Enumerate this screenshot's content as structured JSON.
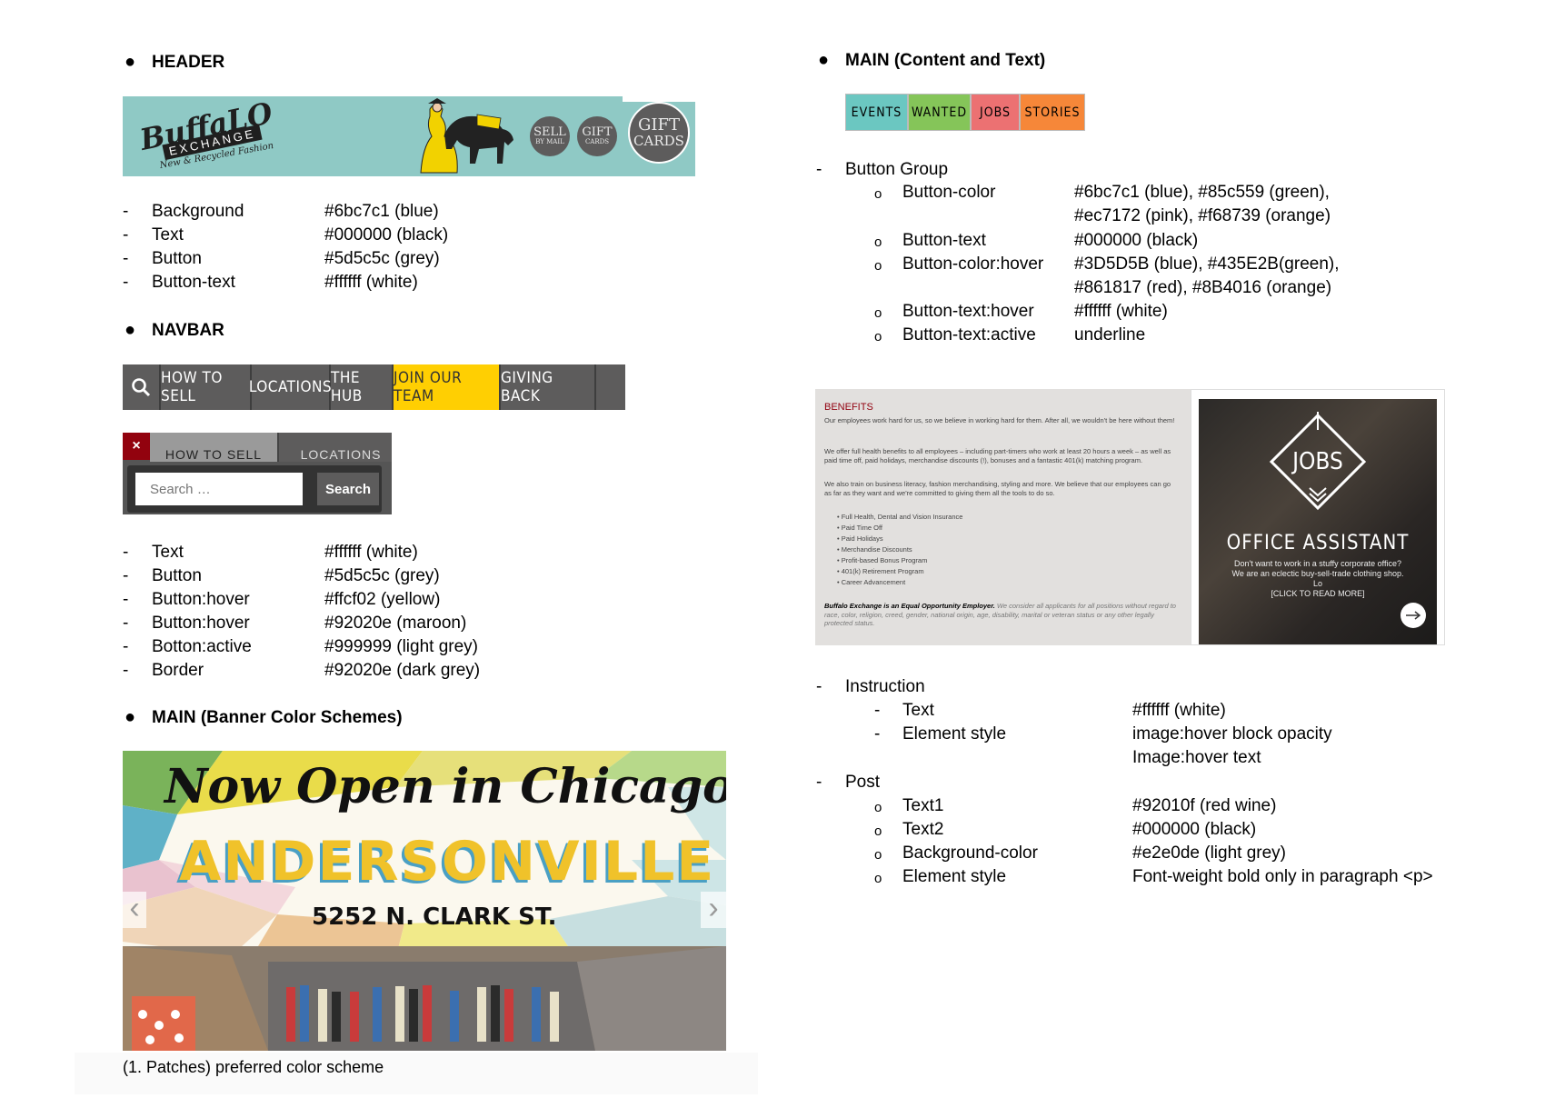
{
  "left": {
    "header_heading": "HEADER",
    "header_image": {
      "logo_word": "BuffaLO",
      "logo_sub": "EXCHANGE",
      "logo_tag": "New & Recycled Fashion",
      "btn_sell_line1": "SELL",
      "btn_sell_line2": "BY MAIL",
      "btn_gift_small_line1": "GIFT",
      "btn_gift_small_line2": "CARDS",
      "btn_gift_big_line1": "GIFT",
      "btn_gift_big_line2": "CARDS"
    },
    "header_props": [
      {
        "label": "Background",
        "value": "#6bc7c1 (blue)"
      },
      {
        "label": "Text",
        "value": "#000000 (black)"
      },
      {
        "label": "Button",
        "value": "#5d5c5c (grey)"
      },
      {
        "label": "Button-text",
        "value": "#ffffff (white)"
      }
    ],
    "navbar_heading": "NAVBAR",
    "navbar_items": [
      "HOW TO SELL",
      "LOCATIONS",
      "THE HUB",
      "JOIN OUR TEAM",
      "GIVING BACK"
    ],
    "navbar_mobile": {
      "close": "×",
      "tab1": "HOW TO SELL",
      "tab2": "LOCATIONS",
      "search_placeholder": "Search …",
      "search_button": "Search"
    },
    "navbar_props": [
      {
        "label": "Text",
        "value": "#ffffff (white)"
      },
      {
        "label": "Button",
        "value": "#5d5c5c (grey)"
      },
      {
        "label": "Button:hover",
        "value": "#ffcf02 (yellow)"
      },
      {
        "label": "Button:hover",
        "value": "#92020e (maroon)"
      },
      {
        "label": "Botton:active",
        "value": "#999999 (light grey)"
      },
      {
        "label": "Border",
        "value": "#92020e (dark grey)"
      }
    ],
    "main_banner_heading": "MAIN (Banner Color Schemes)",
    "banner": {
      "line1": "Now Open in Chicago's",
      "line2": "ANDERSONVILLE",
      "line3": "5252 N. CLARK ST.",
      "prev": "‹",
      "next": "›"
    },
    "banner_caption": "(1. Patches) preferred color scheme"
  },
  "right": {
    "main_content_heading": "MAIN (Content and Text)",
    "tags": [
      {
        "label": "EVENTS",
        "color": "#6bc7c1"
      },
      {
        "label": "WANTED",
        "color": "#85c559"
      },
      {
        "label": "JOBS",
        "color": "#ec7172"
      },
      {
        "label": "STORIES",
        "color": "#f68739"
      }
    ],
    "button_group_label": "Button Group",
    "button_group_props": [
      {
        "label": "Button-color",
        "value": "#6bc7c1 (blue), #85c559 (green),",
        "value2": "#ec7172 (pink), #f68739 (orange)"
      },
      {
        "label": "Button-text",
        "value": "#000000 (black)",
        "value2": ""
      },
      {
        "label": "Button-color:hover",
        "value": "#3D5D5B (blue), #435E2B(green),",
        "value2": "#861817 (red), #8B4016 (orange)"
      },
      {
        "label": "Button-text:hover",
        "value": "#ffffff (white)",
        "value2": ""
      },
      {
        "label": "Button-text:active",
        "value": "underline",
        "value2": ""
      }
    ],
    "benefits": {
      "title": "BENEFITS",
      "p1": "Our employees work hard for us, so we believe in working hard for them. After all, we wouldn't be here without them!",
      "p2": "We offer full health benefits to all employees – including part-timers who work at least 20 hours a week – as well as paid time off, paid holidays, merchandise discounts (!), bonuses and a fantastic 401(k) matching program.",
      "p3": "We also train on business literacy, fashion merchandising, styling and more. We believe that our employees can go as far as they want and we're committed to giving them all the tools to do so.",
      "list": [
        "Full Health, Dental and Vision Insurance",
        "Paid Time Off",
        "Paid Holidays",
        "Merchandise Discounts",
        "Profit-based Bonus Program",
        "401(k) Retirement Program",
        "Career Advancement"
      ],
      "eoe_bold": "Buffalo Exchange is an Equal Opportunity Employer.",
      "eoe_rest": "We consider all applicants for all positions without regard to race, color, religion, creed, gender, national origin, age, disability, marital or veteran status or any other legally protected status."
    },
    "jobs_card": {
      "badge": "JOBS",
      "title": "OFFICE ASSISTANT",
      "line1": "Don't want to work in a stuffy corporate office?",
      "line2": "We are an eclectic buy-sell-trade clothing shop.",
      "line3": "Lo",
      "line4": "[CLICK TO READ MORE]"
    },
    "instruction_label": "Instruction",
    "instruction_props": [
      {
        "label": "Text",
        "value": "#ffffff (white)",
        "value2": ""
      },
      {
        "label": "Element style",
        "value": "image:hover block opacity",
        "value2": "Image:hover text"
      }
    ],
    "post_label": "Post",
    "post_props": [
      {
        "label": "Text1",
        "value": "#92010f (red wine)"
      },
      {
        "label": "Text2",
        "value": "#000000 (black)"
      },
      {
        "label": "Background-color",
        "value": "#e2e0de (light grey)"
      },
      {
        "label": "Element style",
        "value": "Font-weight bold only in paragraph <p>"
      }
    ]
  }
}
